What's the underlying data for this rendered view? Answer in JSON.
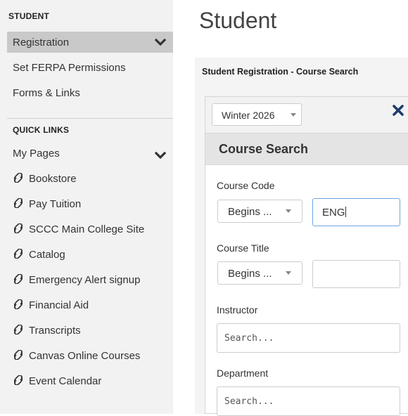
{
  "sidebar": {
    "student_heading": "STUDENT",
    "registration_label": "Registration",
    "items": [
      {
        "label": "Set FERPA Permissions"
      },
      {
        "label": "Forms & Links"
      }
    ],
    "quick_links_heading": "QUICK LINKS",
    "my_pages_label": "My Pages",
    "links": [
      {
        "label": "Bookstore",
        "icon": "link-icon"
      },
      {
        "label": "Pay Tuition",
        "icon": "link-icon"
      },
      {
        "label": "SCCC Main College Site",
        "icon": "link-icon"
      },
      {
        "label": "Catalog",
        "icon": "link-icon"
      },
      {
        "label": "Emergency Alert signup",
        "icon": "link-icon"
      },
      {
        "label": "Financial Aid",
        "icon": "link-icon"
      },
      {
        "label": "Transcripts",
        "icon": "link-icon"
      },
      {
        "label": "Canvas Online Courses",
        "icon": "link-icon"
      },
      {
        "label": "Event Calendar",
        "icon": "link-icon"
      }
    ]
  },
  "main": {
    "page_title": "Student",
    "panel_heading": "Student Registration - Course Search",
    "term_select_value": "Winter 2026",
    "course_search_title": "Course Search",
    "course_code": {
      "label": "Course Code",
      "operator": "Begins ...",
      "value": "ENG"
    },
    "course_title": {
      "label": "Course Title",
      "operator": "Begins ...",
      "value": ""
    },
    "instructor": {
      "label": "Instructor",
      "placeholder": "Search..."
    },
    "department": {
      "label": "Department",
      "placeholder": "Search..."
    }
  },
  "colors": {
    "sidebar_bg": "#f2f2f2",
    "selected_item_bg": "#c9c9c9",
    "section_header_bg": "#e4e4e4",
    "focus_border": "#6ea6e0"
  }
}
